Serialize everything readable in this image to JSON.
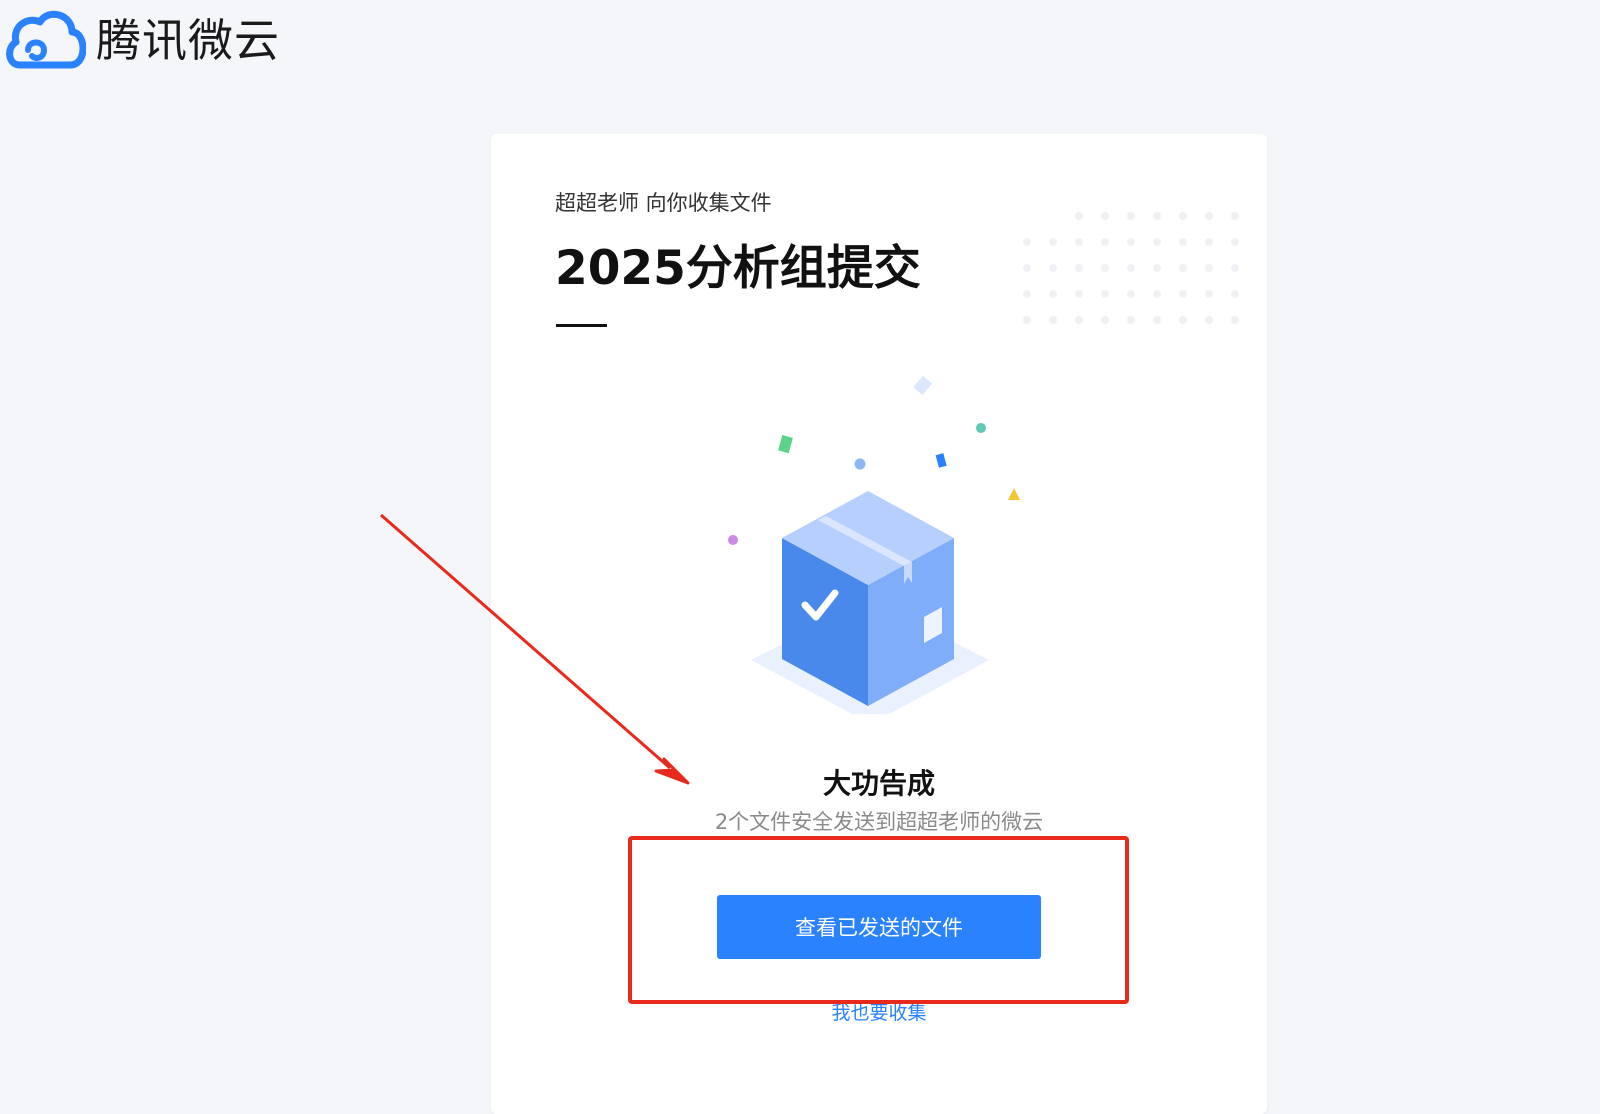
{
  "header": {
    "brand_name": "腾讯微云",
    "brand_icon": "cloud-logo-icon",
    "brand_color": "#2b82ff"
  },
  "card": {
    "collector_line": "超超老师 向你收集文件",
    "task_title": "2025分析组提交",
    "illustration_icon": "package-check-icon",
    "status_heading": "大功告成",
    "status_detail": "2个文件安全发送到超超老师的微云",
    "view_sent_button": "查看已发送的文件",
    "collect_too_link": "我也要收集"
  },
  "annotation": {
    "arrow_color": "#e8291c",
    "box_color": "#e8291c"
  },
  "colors": {
    "page_background": "#f4f6f9",
    "card_background": "#ffffff",
    "accent": "#2b82ff",
    "muted_text": "#8a8a8a"
  }
}
